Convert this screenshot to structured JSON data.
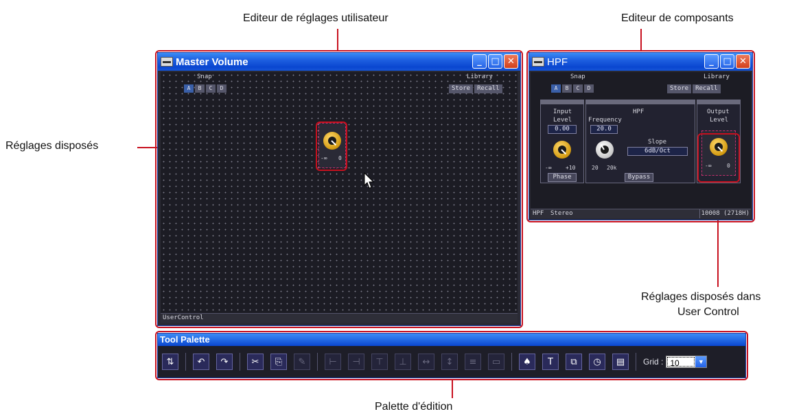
{
  "callouts": {
    "user_editor": "Editeur de réglages utilisateur",
    "component_editor": "Editeur de composants",
    "placed_controls": "Réglages disposés",
    "placed_in_user_control_line1": "Réglages disposés dans",
    "placed_in_user_control_line2": "User Control",
    "tool_palette_caption": "Palette d'édition"
  },
  "master_window": {
    "title": "Master Volume",
    "snap_label": "Snap",
    "snap_buttons": [
      "A",
      "B",
      "C",
      "D"
    ],
    "library_label": "Library",
    "store": "Store",
    "recall": "Recall",
    "knob_min": "-∞",
    "knob_max": "0",
    "status": "UserControl"
  },
  "hpf_window": {
    "title": "HPF",
    "snap_label": "Snap",
    "snap_buttons": [
      "A",
      "B",
      "C",
      "D"
    ],
    "library_label": "Library",
    "store": "Store",
    "recall": "Recall",
    "input_label": "Input",
    "input_level": "Level",
    "input_value": "0.00",
    "input_min": "-∞",
    "input_max": "+10",
    "phase": "Phase",
    "hpf_label": "HPF",
    "frequency_label": "Frequency",
    "frequency_value": "20.0",
    "freq_min": "20",
    "freq_max": "20k",
    "slope_label": "Slope",
    "slope_value": "6dB/Oct",
    "bypass": "Bypass",
    "output_label": "Output",
    "output_level": "Level",
    "output_min": "-∞",
    "output_max": "0",
    "status_name": "HPF",
    "status_type": "Stereo",
    "status_id": "10008 (2718H)"
  },
  "tool_palette": {
    "title": "Tool Palette",
    "grid_label": "Grid :",
    "grid_value": "10"
  },
  "colors": {
    "callout_line": "#c8101e",
    "title_blue": "#0a46d0"
  }
}
